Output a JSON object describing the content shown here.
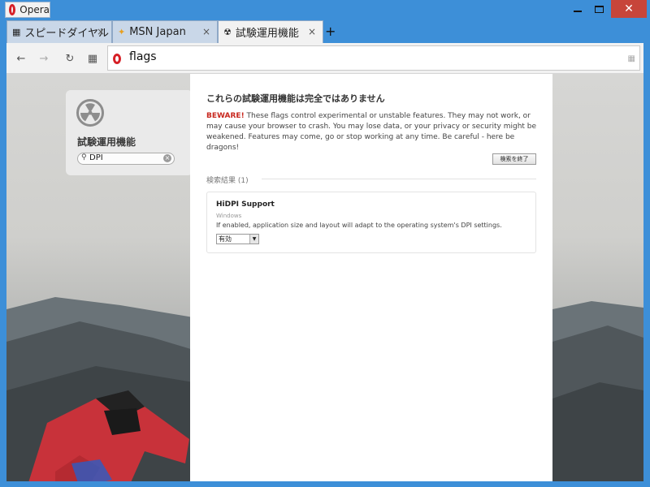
{
  "window": {
    "app_menu_label": "Opera",
    "controls": {
      "minimize": "—",
      "maximize": "□",
      "close": "✕"
    }
  },
  "tabs": [
    {
      "label": "スピードダイヤル",
      "icon": "grid-icon",
      "active": false
    },
    {
      "label": "MSN Japan",
      "icon": "msn-butterfly-icon",
      "active": false
    },
    {
      "label": "試験運用機能",
      "icon": "radiation-icon",
      "active": true
    }
  ],
  "tab_close_glyph": "×",
  "new_tab_glyph": "+",
  "toolbar": {
    "back_glyph": "←",
    "forward_glyph": "→",
    "reload_glyph": "↻",
    "speed_dial_glyph": "▦",
    "address_value": "flags"
  },
  "sidebar": {
    "title": "試験運用機能",
    "search_value": "DPI",
    "clear_glyph": "×"
  },
  "panel": {
    "title": "これらの試験運用機能は完全ではありません",
    "warning_label": "BEWARE!",
    "warning_text": " These flags control experimental or unstable features. They may not work, or may cause your browser to crash. You may lose data, or your privacy or security might be weakened. Features may come, go or stop working at any time. Be careful - here be dragons!",
    "end_search_button": "検索を終了",
    "results_label": "検索結果 (1)"
  },
  "flags": [
    {
      "name": "HiDPI Support",
      "platform": "Windows",
      "description": "If enabled, application size and layout will adapt to the operating system's DPI settings.",
      "selected_option": "有効"
    }
  ],
  "colors": {
    "titlebar": "#3d8fd8",
    "close_button": "#c7453a",
    "opera_red": "#d61f26",
    "beware_red": "#c8281f"
  }
}
